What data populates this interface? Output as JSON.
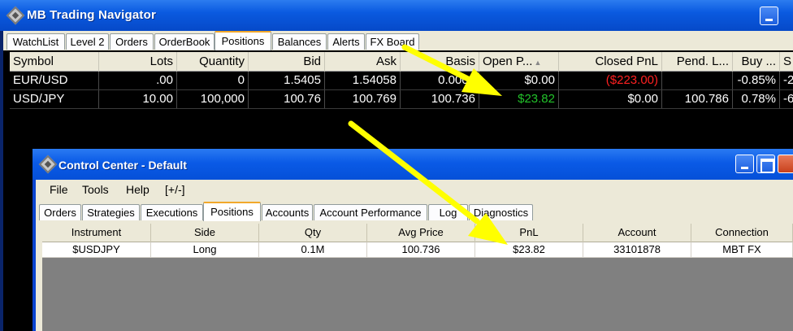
{
  "navigator": {
    "title": "MB Trading Navigator",
    "tabs": [
      "WatchList",
      "Level 2",
      "Orders",
      "OrderBook",
      "Positions",
      "Balances",
      "Alerts",
      "FX Board"
    ],
    "active_tab": "Positions",
    "columns": [
      "Symbol",
      "Lots",
      "Quantity",
      "Bid",
      "Ask",
      "Basis",
      "Open P...",
      "Closed PnL",
      "Pend. L...",
      "Buy ...",
      "S"
    ],
    "rows": [
      [
        "EUR/USD",
        ".00",
        "0",
        "1.5405",
        "1.54058",
        "0.0000",
        "$0.00",
        "($223.00)",
        "",
        "-0.85%",
        "-2"
      ],
      [
        "USD/JPY",
        "10.00",
        "100,000",
        "100.76",
        "100.769",
        "100.736",
        "$23.82",
        "$0.00",
        "100.786",
        "0.78%",
        "-6"
      ]
    ],
    "colors": {
      "negative": "#ff2020",
      "positive": "#22c22a"
    }
  },
  "control_center": {
    "title": "Control Center - Default",
    "menu": [
      "File",
      "Tools",
      "Help",
      "[+/-]"
    ],
    "tabs": [
      "Orders",
      "Strategies",
      "Executions",
      "Positions",
      "Accounts",
      "Account Performance",
      "Log",
      "Diagnostics"
    ],
    "active_tab": "Positions",
    "columns": [
      "Instrument",
      "Side",
      "Qty",
      "Avg Price",
      "PnL",
      "Account",
      "Connection"
    ],
    "rows": [
      [
        "$USDJPY",
        "Long",
        "0.1M",
        "100.736",
        "$23.82",
        "33101878",
        "MBT FX"
      ]
    ]
  },
  "annotation_color": "#ffff00"
}
